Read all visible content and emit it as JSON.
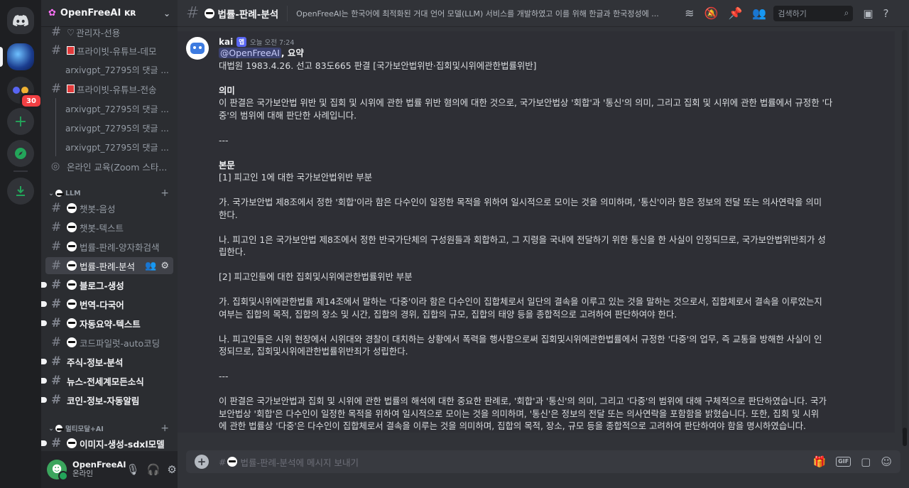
{
  "server": {
    "name": "OpenFreeAI ᴋʀ"
  },
  "rail": {
    "badge": "30"
  },
  "channels_top": [
    {
      "label": "관리자-선용"
    },
    {
      "label": "프라이빗-유튜브-데모"
    },
    {
      "label": "arxivgpt_72795의 댓글 ..."
    },
    {
      "label": "프라이빗-유튜브-전송"
    },
    {
      "label": "arxivgpt_72795의 댓글 ..."
    },
    {
      "label": "arxivgpt_72795의 댓글 ..."
    },
    {
      "label": "arxivgpt_72795의 댓글 ..."
    },
    {
      "label": "온라인 교육(Zoom 스타..."
    }
  ],
  "category_llm": "LLM",
  "channels_llm": [
    {
      "label": "챗봇-음성"
    },
    {
      "label": "챗봇-텍스트"
    },
    {
      "label": "법률-판례-양자화검색"
    },
    {
      "label": "법률-판례-분석"
    },
    {
      "label": "블로그-생성"
    },
    {
      "label": "번역-다국어"
    },
    {
      "label": "자동요약-텍스트"
    },
    {
      "label": "코드파일럿-auto코딩"
    },
    {
      "label": "주식-정보-분석"
    },
    {
      "label": "뉴스-전세계모든소식"
    },
    {
      "label": "코인-정보-자동알림"
    }
  ],
  "category_multi": "멀티모달+AI",
  "channels_multi": [
    {
      "label": "이미지-생성-sdxl모델"
    }
  ],
  "user": {
    "name": "OpenFreeAI",
    "status": "온라인"
  },
  "header": {
    "channel": "법률-판례-분석",
    "topic": "OpenFreeAI는 한국어에 최적화된 거대 언어 모델(LLM) 서비스를 개발하였고 이를 위해 한글과 한국정성에 ...",
    "search_placeholder": "검색하기"
  },
  "message": {
    "author": "kai",
    "app_tag": "앱",
    "time": "오늘 오전 7:24",
    "mention": "@OpenFreeAI",
    "lines": [
      ", 요약",
      "대법원 1983.4.26. 선고 83도665 판결 [국가보안법위반·집회및시위에관한법률위반]",
      "",
      "의미",
      "이 판결은 국가보안법 위반 및 집회 및 시위에 관한 법률 위반 혐의에 대한 것으로, 국가보안법상 '회합'과 '통신'의 의미, 그리고 집회 및 시위에 관한 법률에서 규정한 '다",
      "중'의 범위에 대해 판단한 사례입니다.",
      "",
      "---",
      "",
      "본문",
      "[1] 피고인 1에 대한 국가보안법위반 부분",
      "",
      "가. 국가보안법 제8조에서 정한 '회합'이라 함은 다수인이 일정한 목적을 위하여 일시적으로 모이는 것을 의미하며, '통신'이라 함은 정보의 전달 또는 의사연락을 의미",
      "한다.",
      "",
      "나. 피고인 1은 국가보안법 제8조에서 정한 반국가단체의 구성원들과 회합하고, 그 지령을 국내에 전달하기 위한 통신을 한 사실이 인정되므로, 국가보안법위반죄가 성",
      "립한다.",
      "",
      "[2] 피고인들에 대한 집회및시위에관한법률위반 부분",
      "",
      "가. 집회및시위에관한법률 제14조에서 말하는 '다중'이라 함은 다수인이 집합체로서 일단의 결속을 이루고 있는 것을 말하는 것으로서, 집합체로서 결속을 이루었는지",
      "여부는 집합의 목적, 집합의 장소 및 시간, 집합의 경위, 집합의 규모, 집합의 태양 등을 종합적으로 고려하여 판단하여야 한다.",
      "",
      "나. 피고인들은 시위 현장에서 시위대와 경찰이 대치하는 상황에서 폭력을 행사함으로써 집회및시위에관한법률에서 규정한 '다중'의 업무, 즉 교통을 방해한 사실이 인",
      "정되므로, 집회및시위에관한법률위반죄가 성립한다.",
      "",
      "---",
      "",
      "이 판결은 국가보안법과 집회 및 시위에 관한 법률의 해석에 대한 중요한 판례로, '회합'과 '통신'의 의미, 그리고 '다중'의 범위에 대해 구체적으로 판단하였습니다. 국가",
      "보안법상 '회합'은 다수인이 일정한 목적을 위하여 일시적으로 모이는 것을 의미하며, '통신'은 정보의 전달 또는 의사연락을 포함함을 밝혔습니다. 또한, 집회 및 시위",
      "에 관한 법률상 '다중'은 다수인이 집합체로서 결속을 이루는 것을 의미하며, 집합의 목적, 장소, 규모 등을 종합적으로 고려하여 판단하여야 함을 명시하였습니다."
    ]
  },
  "composer": {
    "placeholder": "법률-판례-분석에 메시지 보내기"
  }
}
